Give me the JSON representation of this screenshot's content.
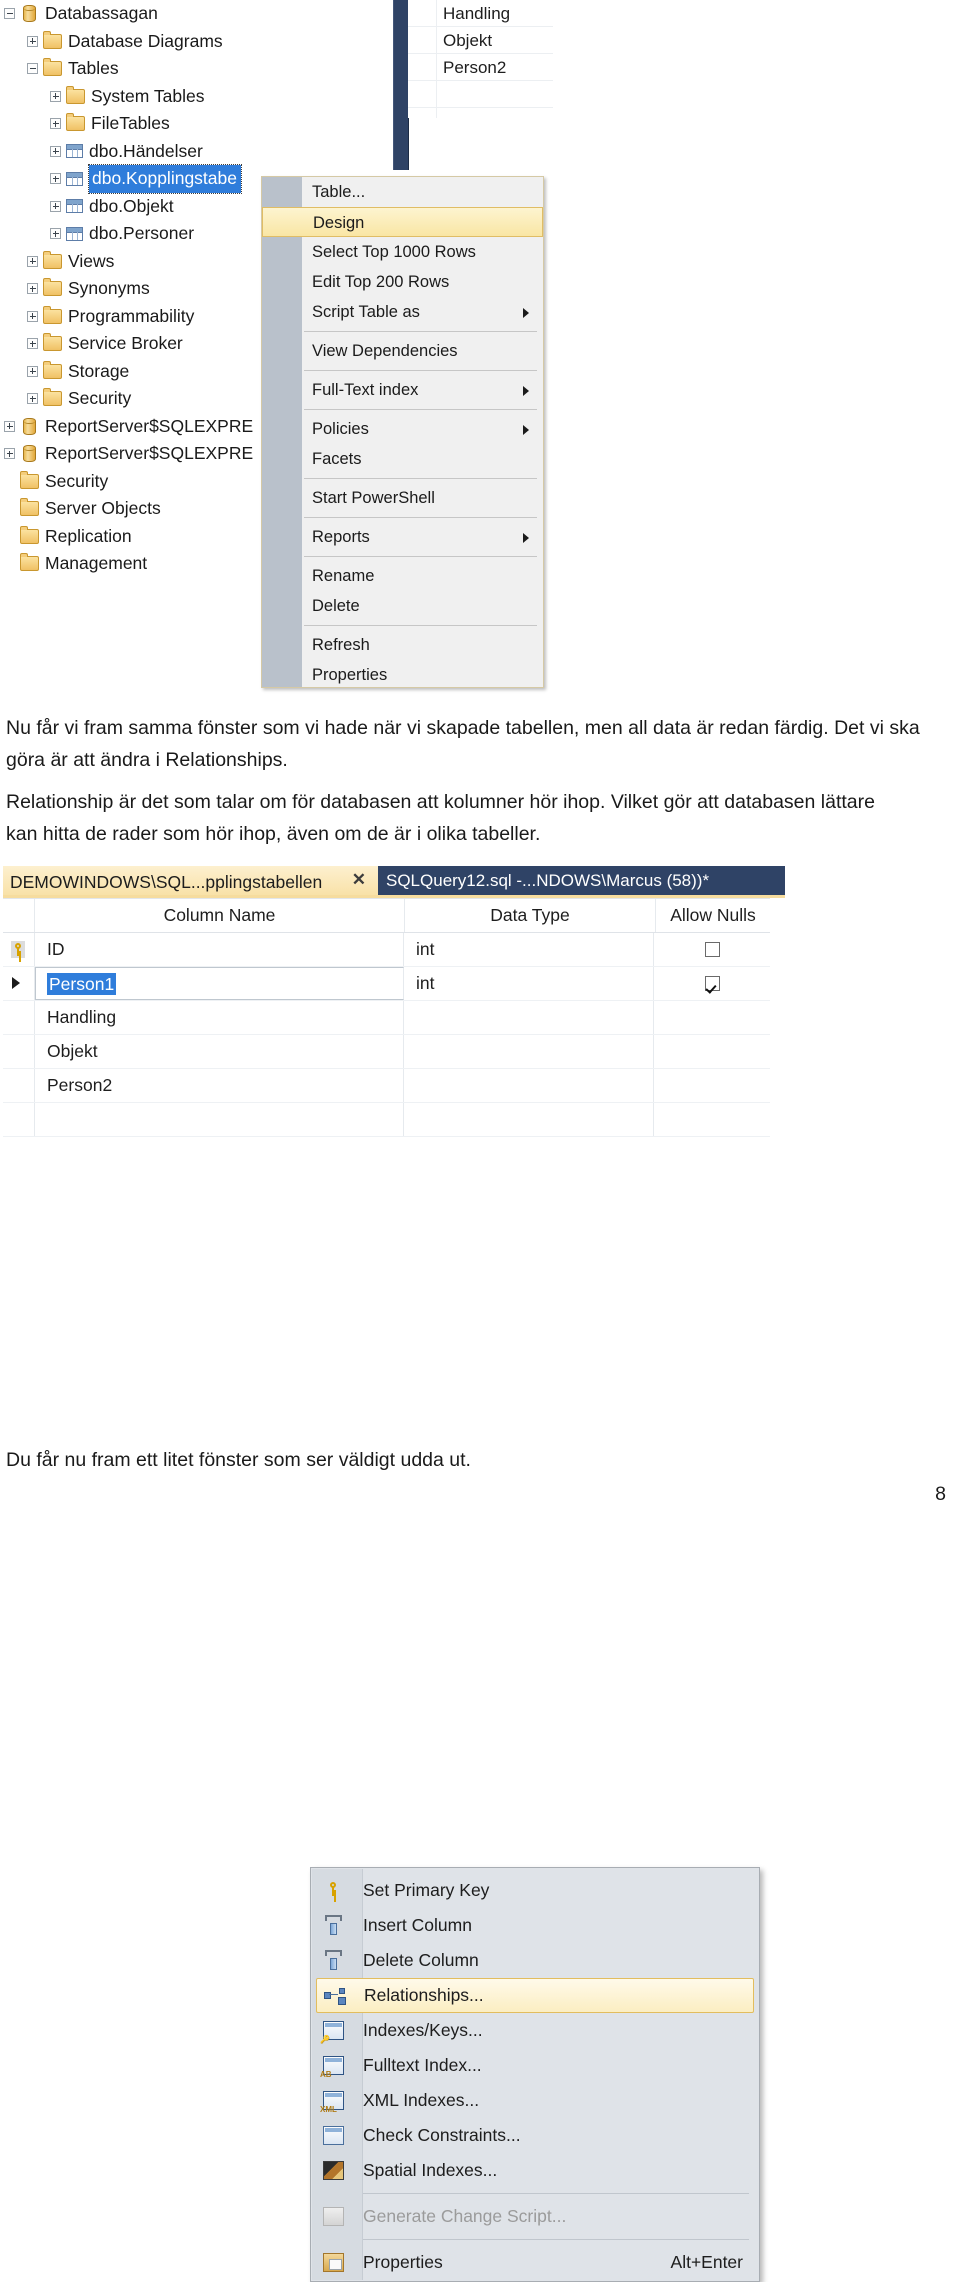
{
  "screenshot1": {
    "object_explorer": {
      "tree": [
        {
          "label": "Databassagan",
          "icon": "database-icon",
          "indent": 0,
          "expander": "minus"
        },
        {
          "label": "Database Diagrams",
          "icon": "folder-icon",
          "indent": 1,
          "expander": "plus"
        },
        {
          "label": "Tables",
          "icon": "folder-icon",
          "indent": 1,
          "expander": "minus"
        },
        {
          "label": "System Tables",
          "icon": "folder-icon",
          "indent": 2,
          "expander": "plus"
        },
        {
          "label": "FileTables",
          "icon": "folder-icon",
          "indent": 2,
          "expander": "plus"
        },
        {
          "label": "dbo.Händelser",
          "icon": "table-icon",
          "indent": 2,
          "expander": "plus"
        },
        {
          "label": "dbo.Kopplingstabe",
          "icon": "table-icon",
          "indent": 2,
          "expander": "plus",
          "selected": true
        },
        {
          "label": "dbo.Objekt",
          "icon": "table-icon",
          "indent": 2,
          "expander": "plus"
        },
        {
          "label": "dbo.Personer",
          "icon": "table-icon",
          "indent": 2,
          "expander": "plus"
        },
        {
          "label": "Views",
          "icon": "folder-icon",
          "indent": 1,
          "expander": "plus"
        },
        {
          "label": "Synonyms",
          "icon": "folder-icon",
          "indent": 1,
          "expander": "plus"
        },
        {
          "label": "Programmability",
          "icon": "folder-icon",
          "indent": 1,
          "expander": "plus"
        },
        {
          "label": "Service Broker",
          "icon": "folder-icon",
          "indent": 1,
          "expander": "plus"
        },
        {
          "label": "Storage",
          "icon": "folder-icon",
          "indent": 1,
          "expander": "plus"
        },
        {
          "label": "Security",
          "icon": "folder-icon",
          "indent": 1,
          "expander": "plus"
        },
        {
          "label": "ReportServer$SQLEXPRE",
          "icon": "database-icon",
          "indent": 0,
          "expander": "plus"
        },
        {
          "label": "ReportServer$SQLEXPRE",
          "icon": "database-icon",
          "indent": 0,
          "expander": "plus"
        },
        {
          "label": "Security",
          "icon": "folder-icon",
          "indent": 0,
          "expander": "none"
        },
        {
          "label": "Server Objects",
          "icon": "folder-icon",
          "indent": 0,
          "expander": "none"
        },
        {
          "label": "Replication",
          "icon": "folder-icon",
          "indent": 0,
          "expander": "none"
        },
        {
          "label": "Management",
          "icon": "folder-icon",
          "indent": 0,
          "expander": "none"
        }
      ]
    },
    "background_grid_rows": [
      "Handling",
      "Objekt",
      "Person2",
      ""
    ],
    "context_menu": {
      "items": [
        {
          "label": "Table...",
          "submenu": false,
          "highlighted": false
        },
        {
          "label": "Design",
          "submenu": false,
          "highlighted": true
        },
        {
          "label": "Select Top 1000 Rows",
          "submenu": false,
          "highlighted": false
        },
        {
          "label": "Edit Top 200 Rows",
          "submenu": false,
          "highlighted": false
        },
        {
          "label": "Script Table as",
          "submenu": true,
          "highlighted": false
        },
        {
          "separator": true
        },
        {
          "label": "View Dependencies",
          "submenu": false,
          "highlighted": false
        },
        {
          "separator": true
        },
        {
          "label": "Full-Text index",
          "submenu": true,
          "highlighted": false
        },
        {
          "separator": true
        },
        {
          "label": "Policies",
          "submenu": true,
          "highlighted": false
        },
        {
          "label": "Facets",
          "submenu": false,
          "highlighted": false
        },
        {
          "separator": true
        },
        {
          "label": "Start PowerShell",
          "submenu": false,
          "highlighted": false
        },
        {
          "separator": true
        },
        {
          "label": "Reports",
          "submenu": true,
          "highlighted": false
        },
        {
          "separator": true
        },
        {
          "label": "Rename",
          "submenu": false,
          "highlighted": false
        },
        {
          "label": "Delete",
          "submenu": false,
          "highlighted": false
        },
        {
          "separator": true
        },
        {
          "label": "Refresh",
          "submenu": false,
          "highlighted": false
        },
        {
          "label": "Properties",
          "submenu": false,
          "highlighted": false
        }
      ]
    }
  },
  "body": {
    "paragraph1": "Nu får vi fram samma fönster som vi hade när vi skapade tabellen, men all data är redan färdig. Det vi ska göra är att ändra i Relationships.",
    "paragraph2": "Relationship är det som talar om för databasen att kolumner hör ihop. Vilket gör att databasen lättare kan hitta de rader som hör ihop, även om de är i olika tabeller.",
    "paragraph3": "Du får nu fram ett litet fönster som ser väldigt udda ut.",
    "page_number": "8"
  },
  "screenshot2": {
    "tabs": [
      {
        "label": "DEMOWINDOWS\\SQL...pplingstabellen",
        "active": true,
        "close": "✕"
      },
      {
        "label": "SQLQuery12.sql -...NDOWS\\Marcus (58))*",
        "active": false
      }
    ],
    "grid": {
      "headers": [
        "Column Name",
        "Data Type",
        "Allow Nulls"
      ],
      "rows": [
        {
          "marker": "key",
          "name": "ID",
          "type": "int",
          "allow_nulls": false,
          "selected": false
        },
        {
          "marker": "current",
          "name": "Person1",
          "type": "int",
          "allow_nulls": true,
          "selected": true
        },
        {
          "marker": "",
          "name": "Handling",
          "type": "",
          "allow_nulls": null,
          "selected": false
        },
        {
          "marker": "",
          "name": "Objekt",
          "type": "",
          "allow_nulls": null,
          "selected": false
        },
        {
          "marker": "",
          "name": "Person2",
          "type": "",
          "allow_nulls": null,
          "selected": false
        },
        {
          "marker": "",
          "name": "",
          "type": "",
          "allow_nulls": null,
          "selected": false
        }
      ]
    },
    "context_menu": {
      "items": [
        {
          "label": "Set Primary Key",
          "icon": "primary-key-icon",
          "accel": "",
          "highlighted": false,
          "disabled": false
        },
        {
          "label": "Insert Column",
          "icon": "insert-column-icon",
          "accel": "",
          "highlighted": false,
          "disabled": false
        },
        {
          "label": "Delete Column",
          "icon": "delete-column-icon",
          "accel": "",
          "highlighted": false,
          "disabled": false
        },
        {
          "label": "Relationships...",
          "icon": "relationships-icon",
          "accel": "",
          "highlighted": true,
          "disabled": false
        },
        {
          "label": "Indexes/Keys...",
          "icon": "indexes-keys-icon",
          "accel": "",
          "highlighted": false,
          "disabled": false
        },
        {
          "label": "Fulltext Index...",
          "icon": "fulltext-index-icon",
          "accel": "",
          "highlighted": false,
          "disabled": false
        },
        {
          "label": "XML Indexes...",
          "icon": "xml-indexes-icon",
          "accel": "",
          "highlighted": false,
          "disabled": false
        },
        {
          "label": "Check Constraints...",
          "icon": "check-constraints-icon",
          "accel": "",
          "highlighted": false,
          "disabled": false
        },
        {
          "label": "Spatial Indexes...",
          "icon": "spatial-indexes-icon",
          "accel": "",
          "highlighted": false,
          "disabled": false
        },
        {
          "separator": true
        },
        {
          "label": "Generate Change Script...",
          "icon": "generate-script-icon",
          "accel": "",
          "highlighted": false,
          "disabled": true
        },
        {
          "separator": true
        },
        {
          "label": "Properties",
          "icon": "properties-icon",
          "accel": "Alt+Enter",
          "highlighted": false,
          "disabled": false
        }
      ]
    }
  },
  "colors": {
    "selection_blue": "#2f7ddb",
    "highlight_yellow": "#f9e6a4",
    "tab_active": "#f8e0a4",
    "tab_inactive_dark": "#2f4366",
    "menu_bg": "#f0f0f0",
    "menu2_bg": "#dfe3e8"
  }
}
